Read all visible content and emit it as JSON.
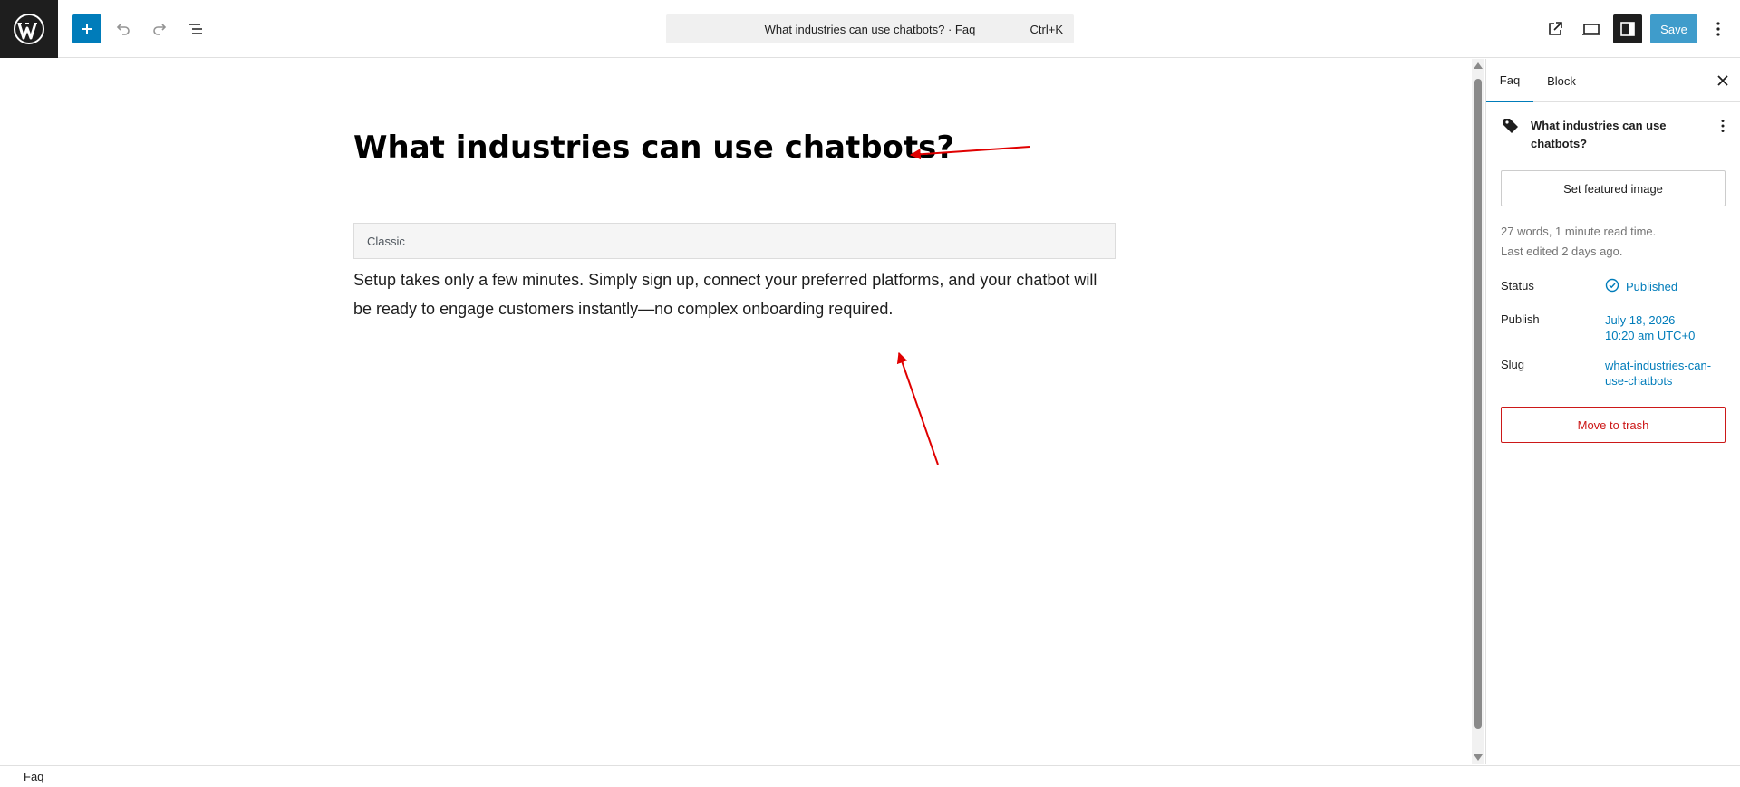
{
  "header": {
    "command_bar_title": "What industries can use chatbots? · Faq",
    "command_bar_shortcut": "Ctrl+K",
    "save_label": "Save"
  },
  "editor": {
    "post_title": "What industries can use chatbots?",
    "classic_block_label": "Classic",
    "classic_block_content": "Setup takes only a few minutes. Simply sign up, connect your preferred platforms, and your chatbot will be ready to engage customers instantly—no complex onboarding required."
  },
  "sidebar": {
    "tabs": [
      {
        "label": "Faq",
        "active": true
      },
      {
        "label": "Block",
        "active": false
      }
    ],
    "summary_title": "What industries can use chatbots?",
    "featured_image_label": "Set featured image",
    "word_count": "27 words, 1 minute read time.",
    "last_edited": "Last edited 2 days ago.",
    "rows": {
      "status": {
        "label": "Status",
        "value": "Published"
      },
      "publish": {
        "label": "Publish",
        "date": "July 18, 2026",
        "time": "10:20 am UTC+0"
      },
      "slug": {
        "label": "Slug",
        "value_line1": "what-industries-can-",
        "value_line2": "use-chatbots"
      }
    },
    "trash_label": "Move to trash"
  },
  "footer": {
    "breadcrumb": "Faq"
  },
  "colors": {
    "accent": "#007cba",
    "danger": "#cc1818",
    "annotation": "#e00000"
  }
}
